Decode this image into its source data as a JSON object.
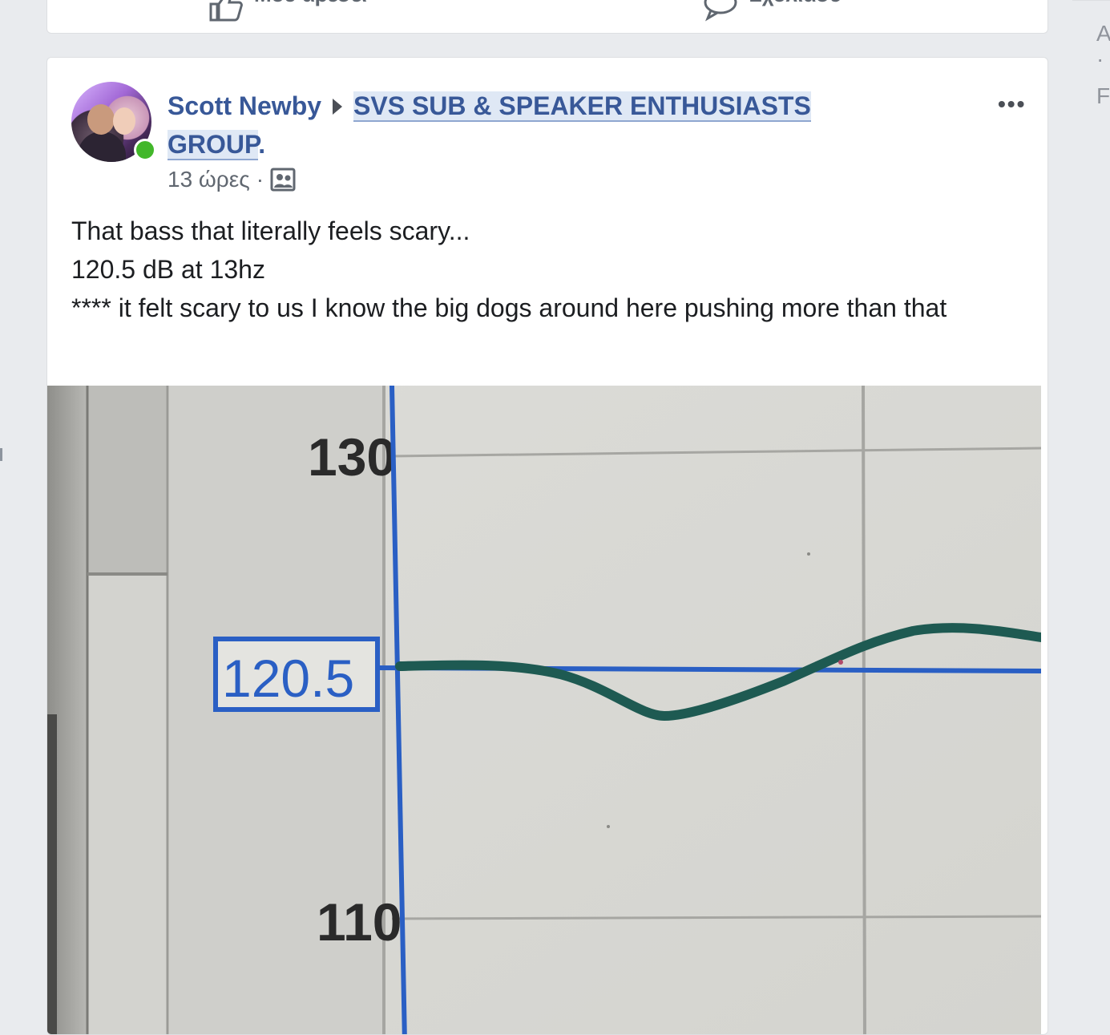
{
  "prev_post": {
    "like_label": "Μου αρέσει",
    "comment_label": "Σχολίασε"
  },
  "right_column": {
    "frag_1": "A",
    "frag_2": "·",
    "frag_3": "F"
  },
  "post": {
    "author": "Scott Newby",
    "group": "SVS SUB & SPEAKER ENTHUSIASTS GROUP",
    "group_suffix": ".",
    "time": "13 ώρες",
    "separator": "·",
    "privacy_icon": "group-members-icon",
    "more_label": "•••",
    "text_lines": [
      "That bass that literally feels scary...",
      "120.5 dB at 13hz",
      "**** it felt scary to us I know the big dogs around here pushing more than that"
    ]
  },
  "photo": {
    "tick_labels": [
      "130",
      "110"
    ],
    "readout": "120.5",
    "colors": {
      "curve": "#1e5a52",
      "cursor": "#2a5fc4",
      "grid": "#a6a6a2",
      "background": "#dcdcd8"
    }
  }
}
